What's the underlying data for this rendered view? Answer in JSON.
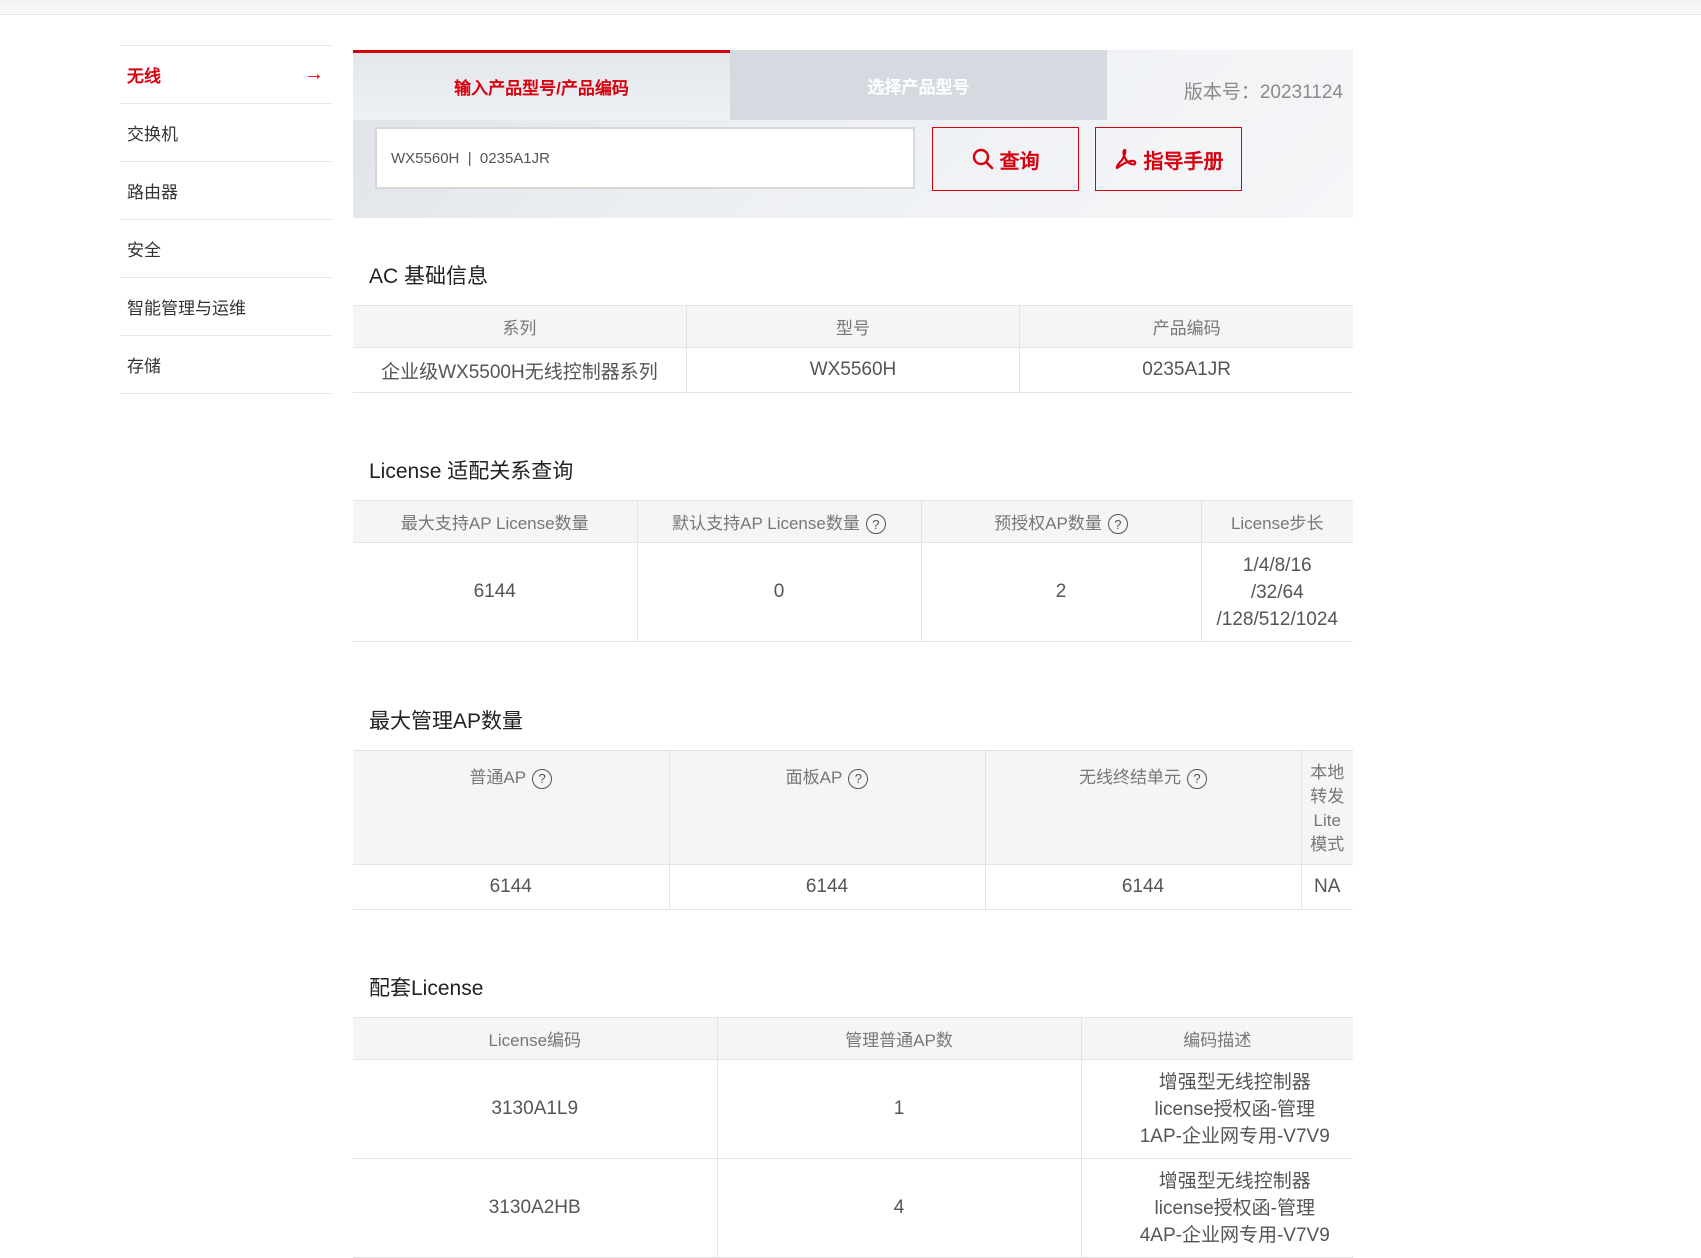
{
  "sidebar": {
    "items": [
      {
        "label": "无线",
        "active": true
      },
      {
        "label": "交换机"
      },
      {
        "label": "路由器"
      },
      {
        "label": "安全"
      },
      {
        "label": "智能管理与运维"
      },
      {
        "label": "存储"
      }
    ]
  },
  "search": {
    "tab_input": "输入产品型号/产品编码",
    "tab_select": "选择产品型号",
    "version": "版本号：20231124",
    "input_value": "WX5560H  |  0235A1JR",
    "query_label": "查询",
    "guide_label": "指导手册"
  },
  "ac_info": {
    "title": "AC 基础信息",
    "headers": [
      "系列",
      "型号",
      "产品编码"
    ],
    "row": [
      "企业级WX5500H无线控制器系列",
      "WX5560H",
      "0235A1JR"
    ]
  },
  "license_fit": {
    "title": "License 适配关系查询",
    "headers": [
      "最大支持AP License数量",
      "默认支持AP License数量",
      "预授权AP数量",
      "License步长"
    ],
    "row": [
      "6144",
      "0",
      "2",
      "1/4/8/16",
      "/32/64",
      "/128/512/1024"
    ]
  },
  "max_ap": {
    "title": "最大管理AP数量",
    "headers": [
      "普通AP",
      "面板AP",
      "无线终结单元",
      "本地",
      "转发",
      "Lite",
      "模式"
    ],
    "row": [
      "6144",
      "6144",
      "6144",
      "NA"
    ]
  },
  "bundle_license": {
    "title": "配套License",
    "headers": [
      "License编码",
      "管理普通AP数",
      "编码描述"
    ],
    "rows": [
      {
        "code": "3130A1L9",
        "count": "1",
        "desc1": "增强型无线控制器",
        "desc2": "license授权函-管理",
        "desc3": "1AP-企业网专用-V7V9"
      },
      {
        "code": "3130A2HB",
        "count": "4",
        "desc1": "增强型无线控制器",
        "desc2": "license授权函-管理",
        "desc3": "4AP-企业网专用-V7V9"
      }
    ]
  },
  "colors": {
    "accent": "#d7000f",
    "header_bg": "#f5f5f5",
    "border": "#e3e3e3"
  }
}
